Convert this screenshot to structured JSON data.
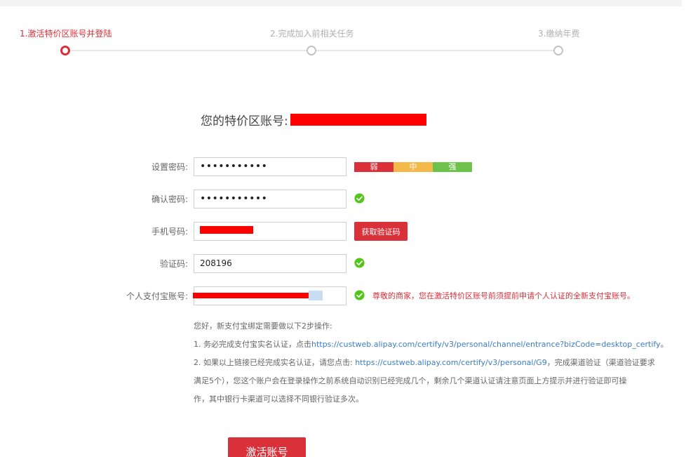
{
  "stepper": {
    "steps": [
      {
        "label": "1.激活特价区账号并登陆",
        "active": true
      },
      {
        "label": "2.完成加入前相关任务",
        "active": false
      },
      {
        "label": "3.缴纳年费",
        "active": false
      }
    ]
  },
  "account": {
    "label": "您的特价区账号: "
  },
  "form": {
    "password": {
      "label": "设置密码:",
      "value": "•••••••••••"
    },
    "confirm": {
      "label": "确认密码:",
      "value": "•••••••••••"
    },
    "phone": {
      "label": "手机号码:"
    },
    "code": {
      "label": "验证码:",
      "value": "208196"
    },
    "alipay": {
      "label": "个人支付宝账号:"
    },
    "strength": [
      {
        "label": "弱",
        "color": "#d9303a"
      },
      {
        "label": "中",
        "color": "#f5b94a"
      },
      {
        "label": "强",
        "color": "#6cc24a"
      }
    ],
    "get_code_label": "获取验证码",
    "alipay_warning": "尊敬的商家，您在激活特价区账号前须提前申请个人认证的全新支付宝账号。"
  },
  "info": {
    "intro": "您好，新支付宝绑定需要做以下2步操作:",
    "step1_prefix": "1. 务必完成支付宝实名认证，点击",
    "step1_link": "https://custweb.alipay.com/certify/v3/personal/channel/entrance?bizCode=desktop_certify",
    "step1_suffix": "。",
    "step2_prefix": "2. 如果以上链接已经完成实名认证，请您点击: ",
    "step2_link": "https://custweb.alipay.com/certify/v3/personal/G9",
    "step2_suffix": "，完成渠道验证（渠道验证要求",
    "step2_line2": "满足5个），您这个账户会在登录操作之前系统自动识别已经完成几个，剩余几个渠道认证请注意页面上方提示并进行验证即可操",
    "step2_line3": "作，其中银行卡渠道可以选择不同银行验证多次。"
  },
  "activate_label": "激活账号",
  "colors": {
    "accent": "#d9303a",
    "success": "#52c41a",
    "link": "#3b7dc4"
  }
}
